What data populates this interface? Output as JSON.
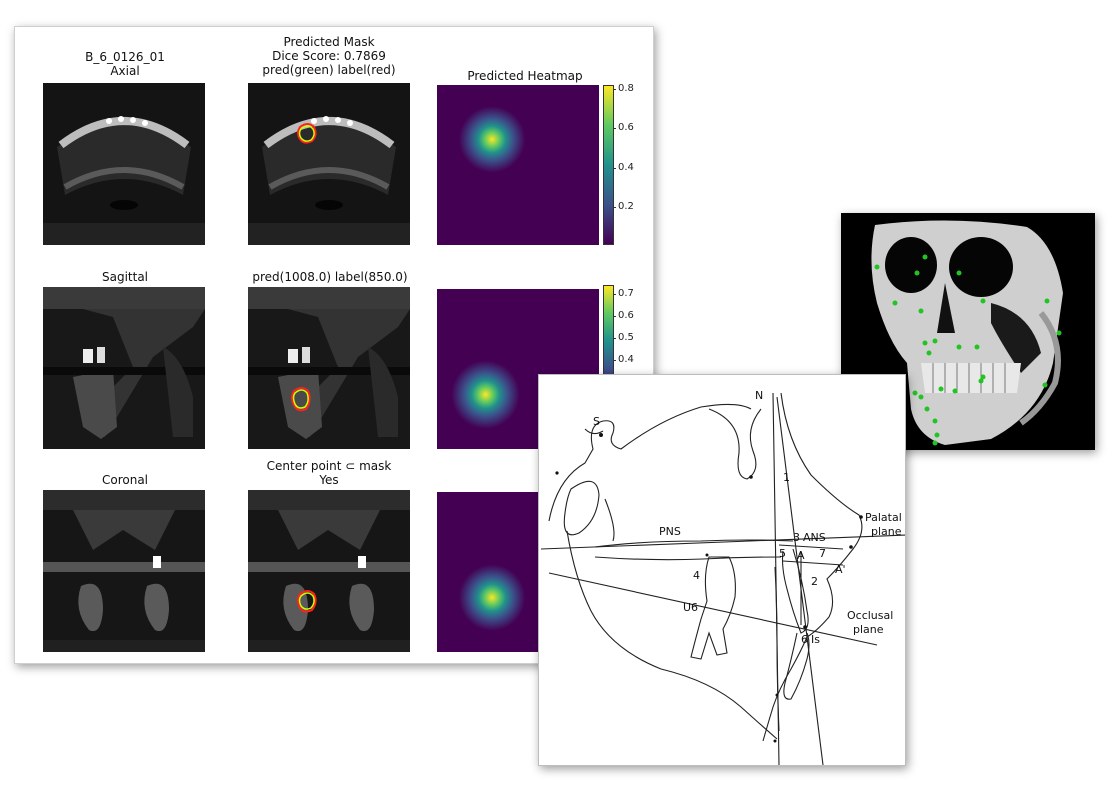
{
  "figure": {
    "axial": {
      "title": "B_6_0126_01",
      "subtitle": "Axial"
    },
    "mask": {
      "title": "Predicted Mask",
      "dice": "Dice Score: 0.7869",
      "legend": "pred(green) label(red)"
    },
    "heatmap": {
      "title": "Predicted Heatmap"
    },
    "sagittal": {
      "title": "Sagittal"
    },
    "pred_label": {
      "title": "pred(1008.0) label(850.0)"
    },
    "coronal": {
      "title": "Coronal"
    },
    "center": {
      "title": "Center point ⊂ mask",
      "value": "Yes"
    },
    "colorbar1": {
      "ticks": [
        "0.8",
        "0.6",
        "0.4",
        "0.2"
      ],
      "range": [
        0.02,
        0.82
      ]
    },
    "colorbar2": {
      "ticks": [
        "0.7",
        "0.6",
        "0.5",
        "0.4"
      ],
      "range": [
        0.02,
        0.74
      ]
    },
    "colors": {
      "viridis_dark": "#440154",
      "viridis_mid": "#21918c",
      "viridis_bright": "#fde725",
      "pred": "#7fff00",
      "label": "#ff2020"
    }
  },
  "cephalogram": {
    "labels": {
      "s": "S",
      "n": "N",
      "pns": "PNS",
      "ans": "ANS",
      "palatal": "Palatal",
      "palatal2": "plane",
      "a": "A",
      "a_prime": "A'",
      "occlusal": "Occlusal",
      "occlusal2": "plane",
      "u6": "U6",
      "is": "Is",
      "n1": "1",
      "n2": "2",
      "n3": "3",
      "n4": "4",
      "n5": "5",
      "n6": "6",
      "n7": "7"
    }
  },
  "render3d": {
    "landmark_color": "#22c422",
    "background": "#000000"
  }
}
